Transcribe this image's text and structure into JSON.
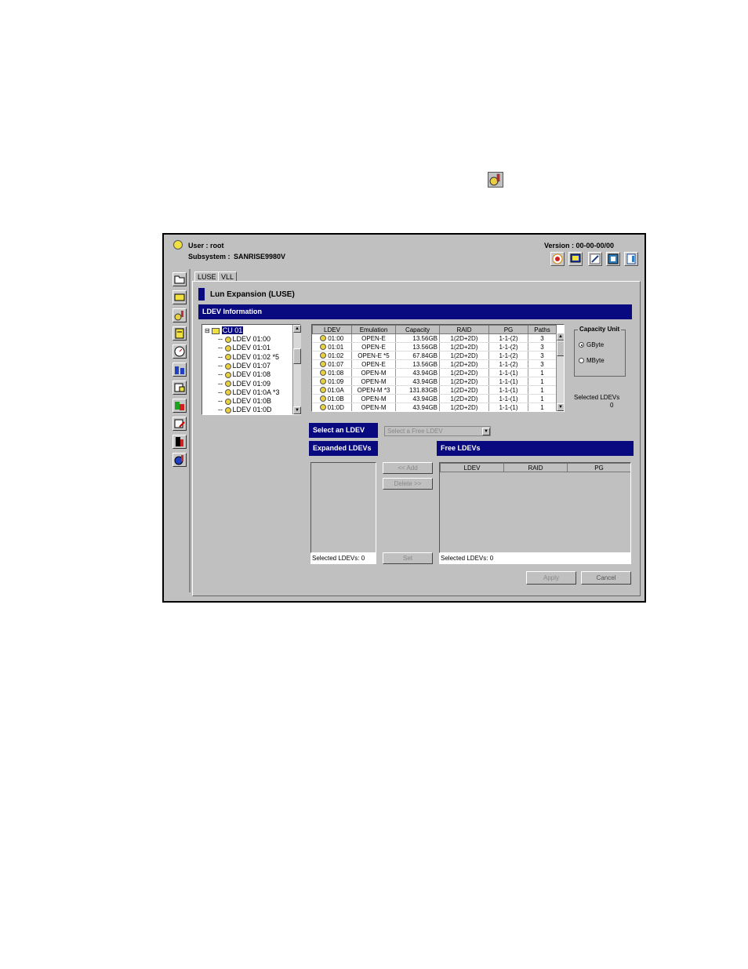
{
  "header": {
    "user_label": "User : root",
    "subsystem_label": "Subsystem :",
    "subsystem_value": "SANRISE9980V",
    "version": "Version : 00-00-00/00"
  },
  "toolbar_icons": [
    "globe-icon",
    "monitor-icon",
    "pen-icon",
    "window-icon",
    "exit-icon"
  ],
  "left_nav_icons": [
    "folder-icon",
    "disk-icon",
    "lun-config-icon",
    "document-icon",
    "gauge-icon",
    "pair-icon",
    "paint-icon",
    "split-icon",
    "export-icon",
    "log-icon",
    "info-icon"
  ],
  "tabs": [
    {
      "label": "LUSE"
    },
    {
      "label": "VLL"
    }
  ],
  "panel": {
    "title": "Lun Expansion (LUSE)",
    "section_title": "LDEV Information"
  },
  "tree": {
    "root": "CU 01",
    "items": [
      "LDEV 01:00",
      "LDEV 01:01",
      "LDEV 01:02 *5",
      "LDEV 01:07",
      "LDEV 01:08",
      "LDEV 01:09",
      "LDEV 01:0A *3",
      "LDEV 01:0B",
      "LDEV 01:0D"
    ]
  },
  "ldev_table": {
    "columns": [
      "LDEV",
      "Emulation",
      "Capacity",
      "RAID",
      "PG",
      "Paths"
    ],
    "rows": [
      [
        "01:00",
        "OPEN-E",
        "13.56GB",
        "1(2D+2D)",
        "1-1-(2)",
        "3"
      ],
      [
        "01:01",
        "OPEN-E",
        "13.56GB",
        "1(2D+2D)",
        "1-1-(2)",
        "3"
      ],
      [
        "01:02",
        "OPEN-E *5",
        "67.84GB",
        "1(2D+2D)",
        "1-1-(2)",
        "3"
      ],
      [
        "01:07",
        "OPEN-E",
        "13.56GB",
        "1(2D+2D)",
        "1-1-(2)",
        "3"
      ],
      [
        "01:08",
        "OPEN-M",
        "43.94GB",
        "1(2D+2D)",
        "1-1-(1)",
        "1"
      ],
      [
        "01:09",
        "OPEN-M",
        "43.94GB",
        "1(2D+2D)",
        "1-1-(1)",
        "1"
      ],
      [
        "01:0A",
        "OPEN-M *3",
        "131.83GB",
        "1(2D+2D)",
        "1-1-(1)",
        "1"
      ],
      [
        "01:0B",
        "OPEN-M",
        "43.94GB",
        "1(2D+2D)",
        "1-1-(1)",
        "1"
      ],
      [
        "01:0D",
        "OPEN-M",
        "43.94GB",
        "1(2D+2D)",
        "1-1-(1)",
        "1"
      ]
    ]
  },
  "capacity_unit": {
    "title": "Capacity Unit",
    "options": [
      "GByte",
      "MByte"
    ],
    "selected": "GByte"
  },
  "selected_ldevs_top": {
    "label": "Selected LDEVs",
    "value": "0"
  },
  "select_ldev": {
    "label": "Select an LDEV",
    "placeholder": "Select a Free LDEV"
  },
  "expanded_ldevs": {
    "title": "Expanded LDEVs",
    "selected_label": "Selected LDEVs:",
    "selected_value": "0"
  },
  "free_ldevs": {
    "title": "Free LDEVs",
    "columns": [
      "LDEV",
      "RAID",
      "PG"
    ],
    "selected_label": "Selected LDEVs:",
    "selected_value": "0"
  },
  "buttons": {
    "add": "<< Add",
    "delete": "Delete >>",
    "set": "Set",
    "apply": "Apply",
    "cancel": "Cancel"
  }
}
